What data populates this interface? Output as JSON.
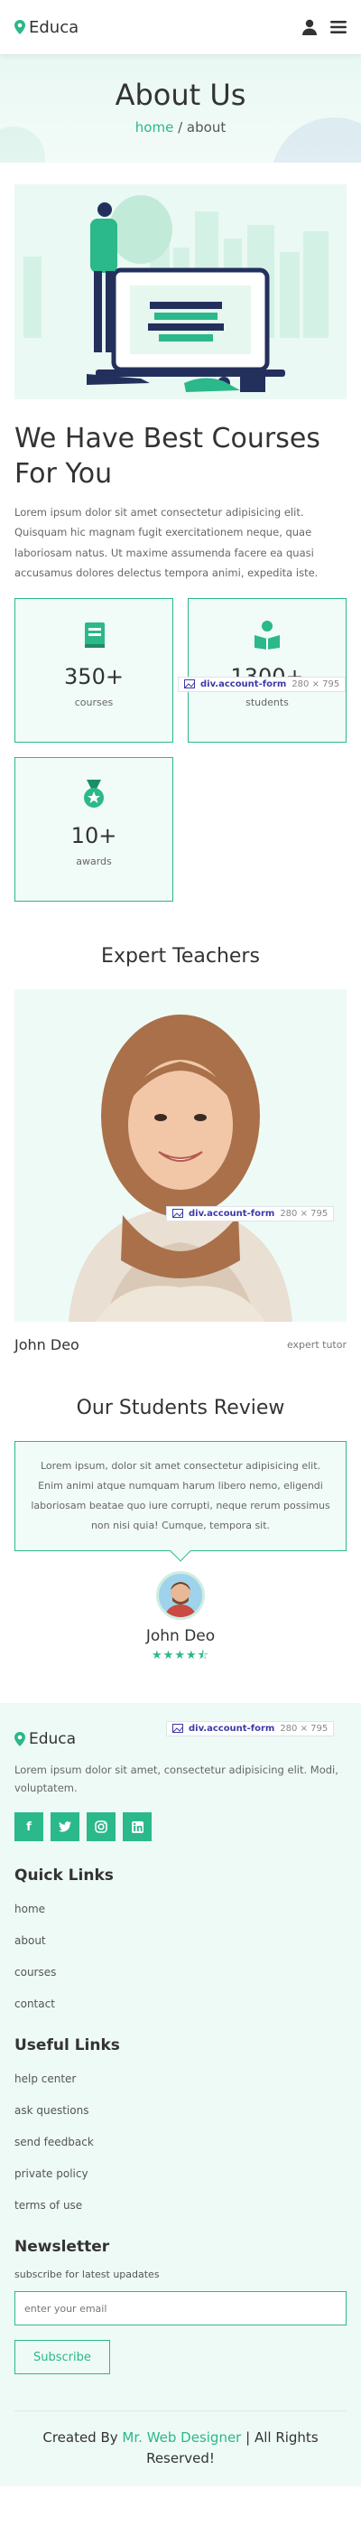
{
  "brand": {
    "name": "Educa",
    "accent": "#2bb88a"
  },
  "header": {
    "user_icon": "user-icon",
    "menu_icon": "menu-icon"
  },
  "hero": {
    "title": "About Us",
    "crumb_home": "home",
    "crumb_sep": " / ",
    "crumb_current": "about"
  },
  "about": {
    "title": "We Have Best Courses For You",
    "text": "Lorem ipsum dolor sit amet consectetur adipisicing elit. Quisquam hic magnam fugit exercitationem neque, quae laboriosam natus. Ut maxime assumenda facere ea quasi accusamus dolores delectus tempora animi, expedita iste."
  },
  "stats": [
    {
      "icon": "book-icon",
      "value": "350+",
      "label": "courses"
    },
    {
      "icon": "student-icon",
      "value": "1300+",
      "label": "students"
    },
    {
      "icon": "medal-icon",
      "value": "10+",
      "label": "awards"
    }
  ],
  "overlay_badge": {
    "name": "div.account-form",
    "size": "280 × 795"
  },
  "teachers": {
    "title": "Expert Teachers",
    "name": "John Deo",
    "role": "expert tutor"
  },
  "reviews": {
    "title": "Our Students Review",
    "text": "Lorem ipsum, dolor sit amet consectetur adipisicing elit. Enim animi atque numquam harum libero nemo, eligendi laboriosam beatae quo iure corrupti, neque rerum possimus non nisi quia! Cumque, tempora sit.",
    "reviewer": "John Deo",
    "stars": "★★★★⯪"
  },
  "footer": {
    "brand": "Educa",
    "desc": "Lorem ipsum dolor sit amet, consectetur adipisicing elit. Modi, voluptatem.",
    "socials": [
      "facebook-icon",
      "twitter-icon",
      "instagram-icon",
      "linkedin-icon"
    ],
    "quick_title": "Quick Links",
    "quick_links": [
      "home",
      "about",
      "courses",
      "contact"
    ],
    "useful_title": "Useful Links",
    "useful_links": [
      "help center",
      "ask questions",
      "send feedback",
      "private policy",
      "terms of use"
    ],
    "newsletter_title": "Newsletter",
    "newsletter_sub": "subscribe for latest upadates",
    "email_placeholder": "enter your email",
    "subscribe_label": "Subscribe",
    "credit_prefix": "Created By ",
    "credit_author": "Mr. Web Designer",
    "credit_suffix": " | All Rights Reserved!"
  }
}
